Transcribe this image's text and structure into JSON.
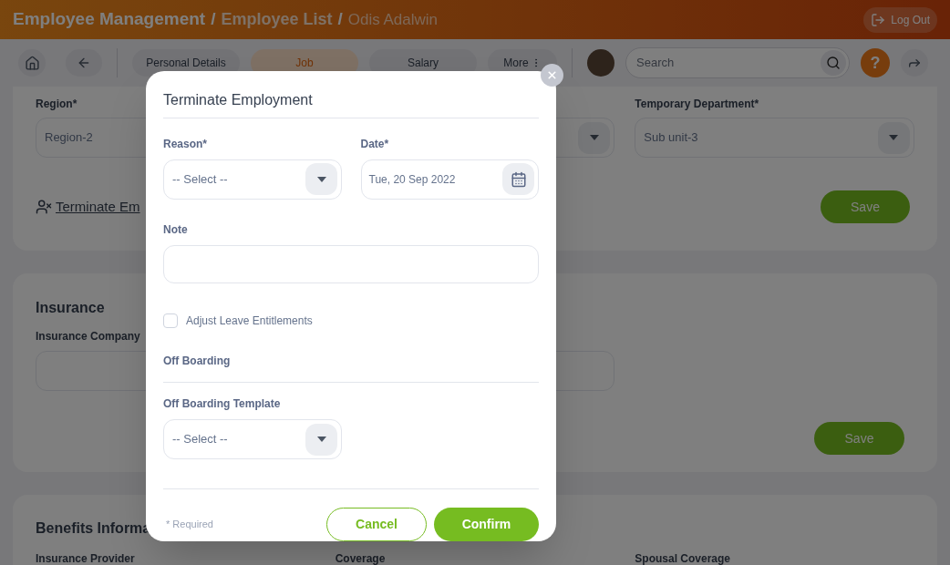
{
  "header": {
    "breadcrumb": [
      {
        "label": "Employee Management",
        "separator_after": "/"
      },
      {
        "label": "Employee List",
        "separator_after": "/"
      },
      {
        "label": "Odis Adalwin"
      }
    ],
    "logout": "Log Out"
  },
  "toolbar": {
    "tabs": [
      {
        "label": "Personal Details",
        "selected": false
      },
      {
        "label": "Job",
        "selected": true
      },
      {
        "label": "Salary",
        "selected": false
      },
      {
        "label": "More",
        "selected": false
      }
    ],
    "search": {
      "placeholder": "Search"
    },
    "help": "?"
  },
  "job_card": {
    "fields": [
      {
        "label": "Region*",
        "value": "Region-2"
      },
      {
        "label": "Temporary Department*",
        "value": "Sub unit-3"
      }
    ],
    "terminate_link": "Terminate Em",
    "save": "Save"
  },
  "insurance_card": {
    "title": "Insurance",
    "field_label": "Insurance Company",
    "save": "Save"
  },
  "benefits_card": {
    "title": "Benefits Informa",
    "columns": [
      "Insurance Provider",
      "Coverage",
      "Spousal Coverage"
    ]
  },
  "modal": {
    "title": "Terminate Employment",
    "reason": {
      "label": "Reason*",
      "placeholder": "-- Select --"
    },
    "date": {
      "label": "Date*",
      "value": "Tue, 20 Sep 2022"
    },
    "note": {
      "label": "Note"
    },
    "adjust_leave": {
      "label": "Adjust Leave Entitlements",
      "checked": false
    },
    "offboarding": {
      "title": "Off Boarding",
      "template_label": "Off Boarding Template",
      "placeholder": "-- Select --"
    },
    "required_note": "* Required",
    "cancel": "Cancel",
    "confirm": "Confirm"
  }
}
